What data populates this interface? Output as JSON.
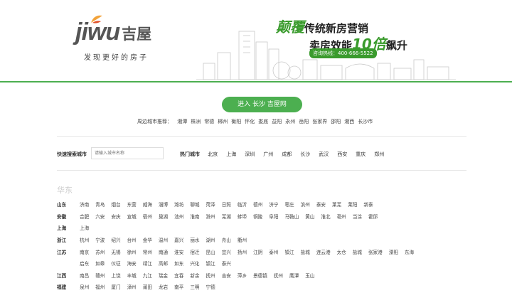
{
  "logo": {
    "en": "jiwu",
    "cn": "吉屋",
    "slogan": "发现更好的房子"
  },
  "banner": {
    "line1_big": "颠覆",
    "line1_rest": "传统新房营销",
    "line2_a": "卖房效能",
    "line2_big": "10倍",
    "line2_b": "飙升",
    "hotline": "咨询热线：400-666-5522"
  },
  "enter_button": "进入 长沙 吉屋网",
  "nearby": {
    "label": "周边城市推荐：",
    "cities": [
      "湘潭",
      "株洲",
      "常德",
      "郴州",
      "衡阳",
      "怀化",
      "娄底",
      "益阳",
      "永州",
      "岳阳",
      "张家界",
      "邵阳",
      "湘西",
      "长沙市"
    ]
  },
  "search": {
    "label": "快速搜索城市",
    "placeholder": "请输入城市名称"
  },
  "hot": {
    "label": "热门城市",
    "cities": [
      "北京",
      "上海",
      "深圳",
      "广州",
      "成都",
      "长沙",
      "武汉",
      "西安",
      "重庆",
      "郑州"
    ]
  },
  "region": "华东",
  "provinces": [
    {
      "name": "山东",
      "cities": [
        "济南",
        "青岛",
        "烟台",
        "东营",
        "威海",
        "淄博",
        "潍坊",
        "聊城",
        "菏泽",
        "日照",
        "临沂",
        "德州",
        "济宁",
        "枣庄",
        "滨州",
        "泰安",
        "莱芜",
        "莱阳",
        "新泰"
      ]
    },
    {
      "name": "安徽",
      "cities": [
        "合肥",
        "六安",
        "安庆",
        "宣城",
        "宿州",
        "巢湖",
        "池州",
        "淮南",
        "滁州",
        "芜湖",
        "蚌埠",
        "铜陵",
        "阜阳",
        "马鞍山",
        "黄山",
        "淮北",
        "亳州",
        "当涂",
        "霍邱"
      ]
    },
    {
      "name": "上海",
      "cities": [
        "上海"
      ]
    },
    {
      "name": "浙江",
      "cities": [
        "杭州",
        "宁波",
        "绍兴",
        "台州",
        "金华",
        "温州",
        "嘉兴",
        "丽水",
        "湖州",
        "舟山",
        "衢州"
      ]
    },
    {
      "name": "江苏",
      "cities": [
        "南京",
        "苏州",
        "无锡",
        "徐州",
        "常州",
        "南通",
        "淮安",
        "宿迁",
        "昆山",
        "宜兴",
        "扬州",
        "江阴",
        "泰州",
        "镇江",
        "盐城",
        "连云港",
        "太仓",
        "盐城",
        "张家港",
        "溧阳",
        "东海"
      ]
    },
    {
      "name": "",
      "cities": [
        "启东",
        "如皋",
        "仪征",
        "海安",
        "靖江",
        "高邮",
        "如东",
        "兴化",
        "镇江",
        "泰兴"
      ]
    },
    {
      "name": "江西",
      "cities": [
        "南昌",
        "赣州",
        "上饶",
        "丰城",
        "九江",
        "瑞金",
        "宜春",
        "新余",
        "抚州",
        "吉安",
        "萍乡",
        "景德镇",
        "抚州",
        "鹰潭",
        "玉山"
      ]
    },
    {
      "name": "福建",
      "cities": [
        "泉州",
        "福州",
        "厦门",
        "漳州",
        "莆田",
        "龙岩",
        "南平",
        "三明",
        "宁德"
      ]
    }
  ],
  "colors": {
    "accent": "#4caf50",
    "brand_green": "#3a9b2d"
  }
}
